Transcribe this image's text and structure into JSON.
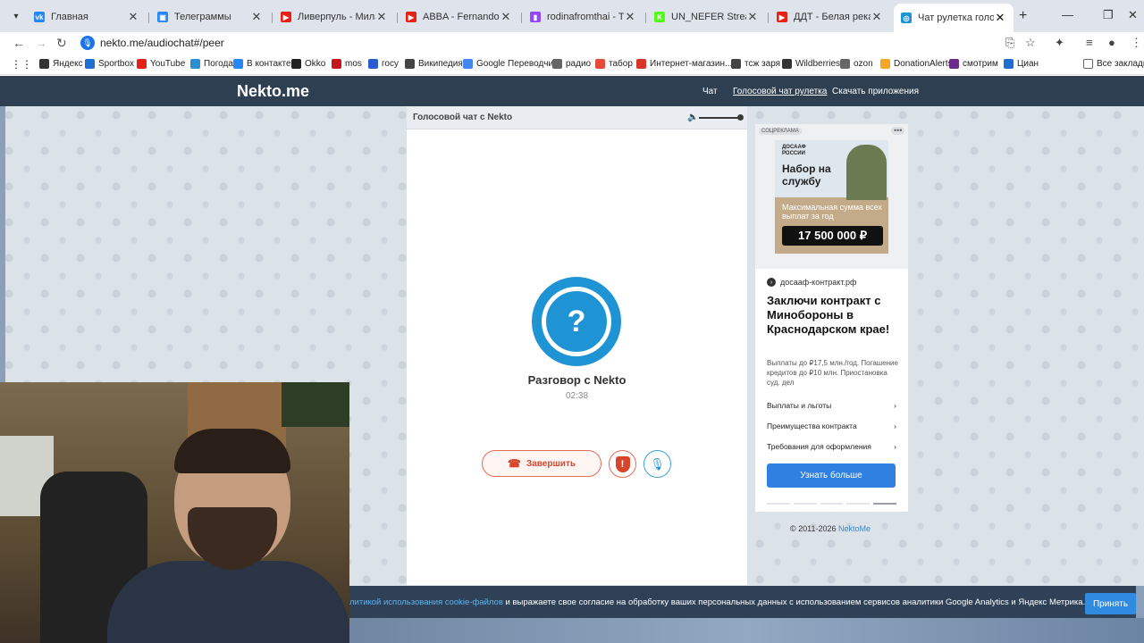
{
  "browser": {
    "tabs": [
      {
        "title": "Главная",
        "color": "#2787f5",
        "glyph": "vk"
      },
      {
        "title": "Телеграммы",
        "color": "#2787f5",
        "glyph": "▣"
      },
      {
        "title": "Ливерпуль - Милан. Пре",
        "color": "#e62117",
        "glyph": "▶"
      },
      {
        "title": "ABBA - Fernando (Officia",
        "color": "#e62117",
        "glyph": "▶"
      },
      {
        "title": "rodinafromthai - Twitch",
        "color": "#9146ff",
        "glyph": "▮"
      },
      {
        "title": "UN_NEFER Stream - Watc",
        "color": "#53fc18",
        "glyph": "K"
      },
      {
        "title": "ДДТ - Белая река (Offici",
        "color": "#e62117",
        "glyph": "▶"
      },
      {
        "title": "Чат рулетка голосов",
        "color": "#1e94d4",
        "glyph": "◎"
      }
    ],
    "url": "nekto.me/audiochat#/peer",
    "bookmarks": [
      {
        "label": "Яндекс",
        "color": "#333"
      },
      {
        "label": "Sportbox",
        "color": "#1e6fd0"
      },
      {
        "label": "YouTube",
        "color": "#e62117"
      },
      {
        "label": "Погода",
        "color": "#2a8fd0"
      },
      {
        "label": "В контакте",
        "color": "#2787f5"
      },
      {
        "label": "Okko",
        "color": "#222"
      },
      {
        "label": "mos",
        "color": "#c4161c"
      },
      {
        "label": "госу",
        "color": "#2a5bd0"
      },
      {
        "label": "Википедия",
        "color": "#444"
      },
      {
        "label": "Google Переводчик",
        "color": "#4285f4"
      },
      {
        "label": "радио",
        "color": "#666"
      },
      {
        "label": "табор",
        "color": "#e84a3a"
      },
      {
        "label": "Интернет-магазин...",
        "color": "#d8352a"
      },
      {
        "label": "тсж заря",
        "color": "#444"
      },
      {
        "label": "Wildberries",
        "color": "#333"
      },
      {
        "label": "ozon",
        "color": "#666"
      },
      {
        "label": "DonationAlerts",
        "color": "#f5a623"
      },
      {
        "label": "смотрим",
        "color": "#6a2a8a"
      },
      {
        "label": "Циан",
        "color": "#1e6fd0"
      }
    ],
    "all_bookmarks": "Все закладки"
  },
  "site": {
    "logo": "Nekto.me",
    "nav": [
      "Чат",
      "Голосовой чат рулетка",
      "Скачать приложения"
    ]
  },
  "chat": {
    "header": "Голосовой чат с Nekto",
    "avatar_glyph": "?",
    "title": "Разговор с Nekto",
    "timer": "02:38",
    "end_label": "Завершить",
    "volume": 1.0
  },
  "ad": {
    "badge": "СОЦРЕКЛАМА",
    "banner_org": "ДОСААФ РОССИИ",
    "banner_heading": "Набор на службу",
    "banner_sub": "Максимальная сумма всех выплат за год",
    "banner_sum": "17 500 000 ₽",
    "domain": "досааф-контракт.рф",
    "title": "Заключи контракт с Минобороны в Краснодарском крае!",
    "desc": "Выплаты до ₽17,5 млн./год. Погашение кредитов до ₽10 млн. Приостановка суд. дел",
    "links": [
      "Выплаты и льготы",
      "Преимущества контракта",
      "Требования для оформления"
    ],
    "cta": "Узнать больше"
  },
  "footer": {
    "copyright": "© 2011-2026",
    "copyright_link": "NektoMe"
  },
  "cookie": {
    "link_text": "литикой использования cookie-файлов",
    "text": " и выражаете свое согласие на обработку ваших персональных данных с использованием сервисов аналитики Google Analytics и Яндекс Метрика.",
    "accept": "Принять"
  }
}
